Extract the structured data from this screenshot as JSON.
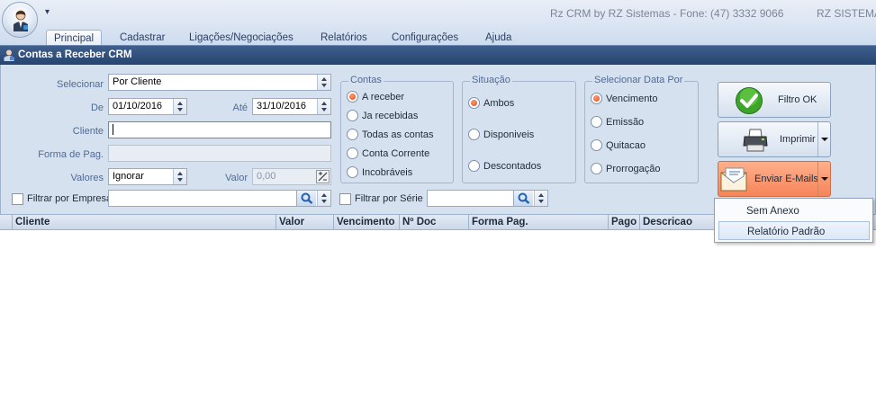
{
  "app": {
    "title": "Rz CRM by RZ Sistemas - Fone: (47) 3332 9066",
    "title_right": "RZ SISTEMA:",
    "qat_symbol": "▾"
  },
  "ribbon": {
    "tabs": [
      {
        "label": "Principal",
        "active": true
      },
      {
        "label": "Cadastrar",
        "active": false
      },
      {
        "label": "Ligações/Negociações",
        "active": false
      },
      {
        "label": "Relatórios",
        "active": false
      },
      {
        "label": "Configurações",
        "active": false
      },
      {
        "label": "Ajuda",
        "active": false
      }
    ]
  },
  "window": {
    "title": "Contas a Receber CRM"
  },
  "filters": {
    "selecionar_label": "Selecionar",
    "selecionar_value": "Por Cliente",
    "de_label": "De",
    "de_value": "01/10/2016",
    "ate_label": "Até",
    "ate_value": "31/10/2016",
    "cliente_label": "Cliente",
    "cliente_value": "",
    "forma_label": "Forma de Pag.",
    "forma_value": "",
    "valores_label": "Valores",
    "valores_value": "Ignorar",
    "valor_label": "Valor",
    "valor_value": "0,00",
    "filtrar_empresa_label": "Filtrar por Empresa",
    "filtrar_empresa_checked": false,
    "filtrar_serie_label": "Filtrar por Série",
    "filtrar_serie_checked": false
  },
  "groups": {
    "contas": {
      "title": "Contas",
      "options": [
        {
          "label": "A receber",
          "selected": true
        },
        {
          "label": "Ja recebidas",
          "selected": false
        },
        {
          "label": "Todas as contas",
          "selected": false
        },
        {
          "label": "Conta Corrente",
          "selected": false
        },
        {
          "label": "Incobráveis",
          "selected": false
        }
      ]
    },
    "situacao": {
      "title": "Situação",
      "options": [
        {
          "label": "Ambos",
          "selected": true
        },
        {
          "label": "Disponiveis",
          "selected": false
        },
        {
          "label": "Descontados",
          "selected": false
        }
      ]
    },
    "data_por": {
      "title": "Selecionar Data Por",
      "options": [
        {
          "label": "Vencimento",
          "selected": true
        },
        {
          "label": "Emissão",
          "selected": false
        },
        {
          "label": "Quitacao",
          "selected": false
        },
        {
          "label": "Prorrogação",
          "selected": false
        }
      ]
    }
  },
  "buttons": {
    "filtro_ok": "Filtro OK",
    "imprimir": "Imprimir",
    "enviar_emails": "Enviar E-Mails"
  },
  "menu": {
    "items": [
      {
        "label": "Sem Anexo",
        "hover": false
      },
      {
        "label": "Relatório Padrão",
        "hover": true
      }
    ]
  },
  "grid": {
    "columns": [
      "Cliente",
      "Valor",
      "Vencimento",
      "Nº Doc",
      "Forma Pag.",
      "Pago",
      "Descricao"
    ]
  },
  "colors": {
    "accent_radio": "#e2471a",
    "mail_button": "#f6845a",
    "window_bar": "#26446f",
    "panel_bg": "#d6e1ef"
  }
}
